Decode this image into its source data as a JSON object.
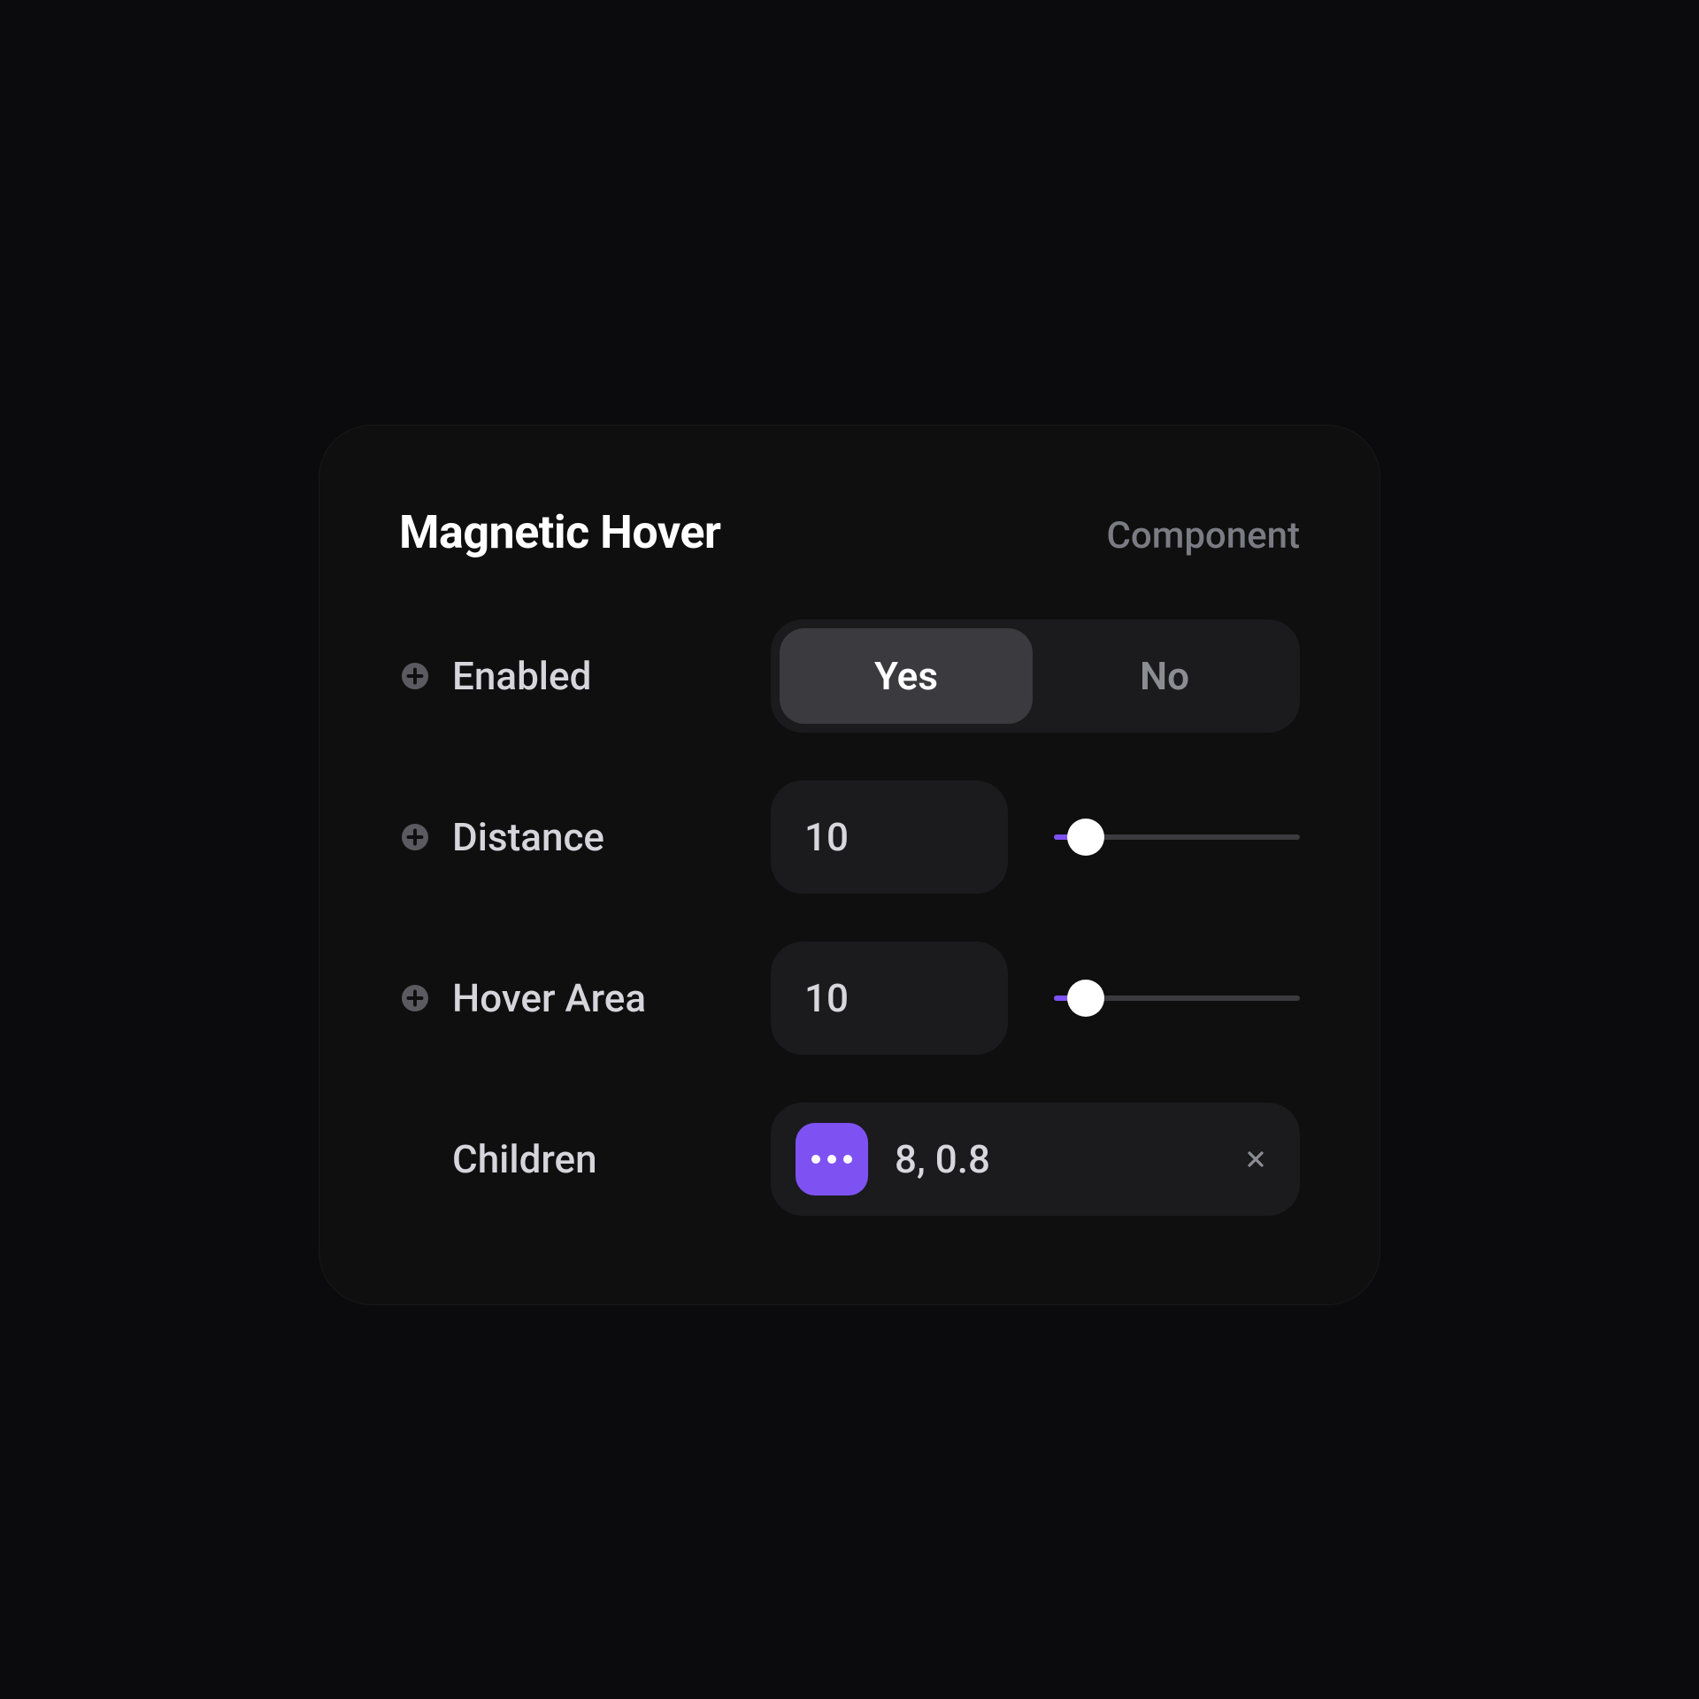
{
  "panel": {
    "title": "Magnetic Hover",
    "tag": "Component"
  },
  "rows": {
    "enabled": {
      "label": "Enabled",
      "options": {
        "yes": "Yes",
        "no": "No"
      },
      "selected": "yes"
    },
    "distance": {
      "label": "Distance",
      "value": "10",
      "slider_percent": 13
    },
    "hover_area": {
      "label": "Hover Area",
      "value": "10",
      "slider_percent": 13
    },
    "children": {
      "label": "Children",
      "tag_value": "8, 0.8"
    }
  },
  "colors": {
    "accent": "#7e52f2",
    "panel_bg": "#0f0f10",
    "field_bg": "#1b1b1e"
  }
}
